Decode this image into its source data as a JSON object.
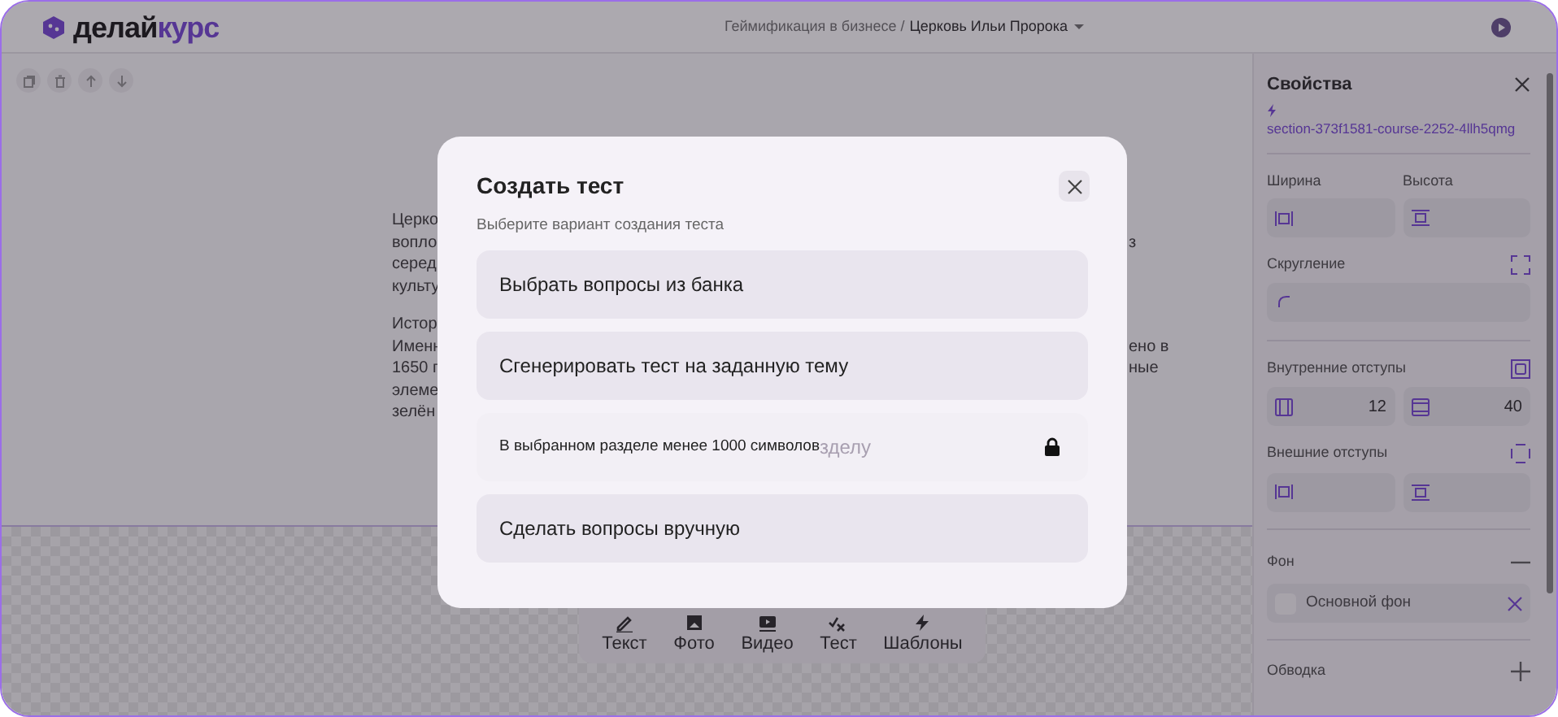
{
  "header": {
    "logo": {
      "part1": "делай",
      "part2": "курс"
    },
    "breadcrumb": {
      "parent": "Геймификация в бизнесе /",
      "current": "Церковь Ильи Пророка"
    }
  },
  "canvas": {
    "paragraphs": [
      [
        {
          "left": "Церко"
        },
        {
          "left": "вопло",
          "right": "з"
        },
        {
          "left": "серед"
        },
        {
          "left": "культу"
        }
      ],
      [
        {
          "left": "Истор"
        },
        {
          "left": "Именн",
          "right": "ено в"
        },
        {
          "left": "1650 г",
          "right": "ные"
        },
        {
          "left": "элеме"
        },
        {
          "left": "зелён"
        }
      ]
    ],
    "insert_toolbar": [
      {
        "kind": "text",
        "label": "Текст"
      },
      {
        "kind": "photo",
        "label": "Фото"
      },
      {
        "kind": "video",
        "label": "Видео"
      },
      {
        "kind": "test",
        "label": "Тест"
      },
      {
        "kind": "templates",
        "label": "Шаблоны"
      }
    ]
  },
  "sidebar": {
    "title": "Свойства",
    "element_id": "section-373f1581-course-2252-4llh5qmg",
    "size": {
      "width_label": "Ширина",
      "height_label": "Высота"
    },
    "radius": {
      "label": "Скругление"
    },
    "padding": {
      "label": "Внутренние отступы",
      "horizontal": "12",
      "vertical": "40"
    },
    "margin": {
      "label": "Внешние отступы"
    },
    "background": {
      "label": "Фон",
      "expanded": true,
      "value": "Основной фон"
    },
    "border": {
      "label": "Обводка",
      "expanded": false
    }
  },
  "modal": {
    "title": "Создать тест",
    "subtitle": "Выберите вариант создания теста",
    "options": [
      {
        "label": "Выбрать вопросы из банка",
        "locked": false
      },
      {
        "label": "Сгенерировать тест на заданную тему",
        "locked": false
      },
      {
        "label": "зделу",
        "locked": true,
        "note": "В выбранном разделе менее 1000 символов"
      },
      {
        "label": "Сделать вопросы вручную",
        "locked": false
      }
    ]
  }
}
